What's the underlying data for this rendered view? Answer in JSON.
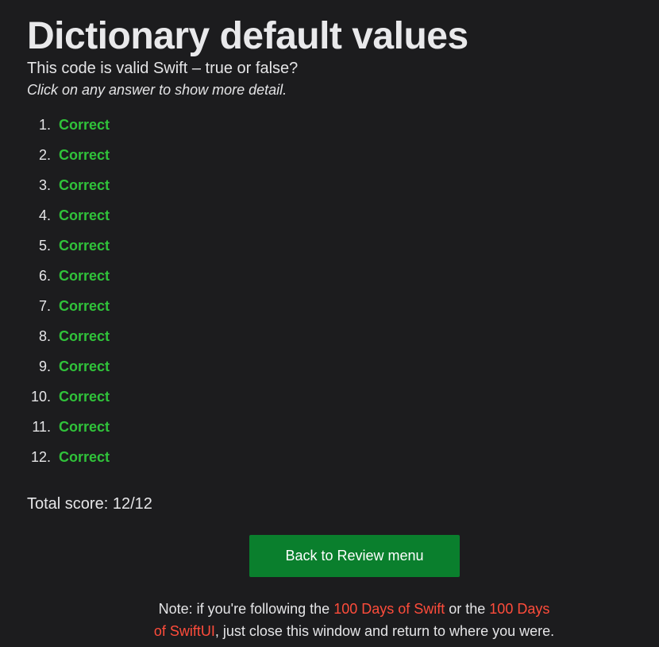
{
  "page": {
    "title": "Dictionary default values",
    "subtitle": "This code is valid Swift – true or false?",
    "hint": "Click on any answer to show more detail."
  },
  "answers": [
    {
      "number": "1.",
      "result": "Correct"
    },
    {
      "number": "2.",
      "result": "Correct"
    },
    {
      "number": "3.",
      "result": "Correct"
    },
    {
      "number": "4.",
      "result": "Correct"
    },
    {
      "number": "5.",
      "result": "Correct"
    },
    {
      "number": "6.",
      "result": "Correct"
    },
    {
      "number": "7.",
      "result": "Correct"
    },
    {
      "number": "8.",
      "result": "Correct"
    },
    {
      "number": "9.",
      "result": "Correct"
    },
    {
      "number": "10.",
      "result": "Correct"
    },
    {
      "number": "11.",
      "result": "Correct"
    },
    {
      "number": "12.",
      "result": "Correct"
    }
  ],
  "score": {
    "text": "Total score: 12/12"
  },
  "button": {
    "label": "Back to Review menu"
  },
  "note": {
    "prefix": "Note: if you're following the ",
    "link1": "100 Days of Swift",
    "middle": " or the ",
    "link2": "100 Days of SwiftUI",
    "suffix": ", just close this window and return to where you were."
  },
  "colors": {
    "background": "#1c1c1e",
    "correct": "#30c23a",
    "button": "#0a7f2d",
    "link": "#ff4c3b"
  }
}
